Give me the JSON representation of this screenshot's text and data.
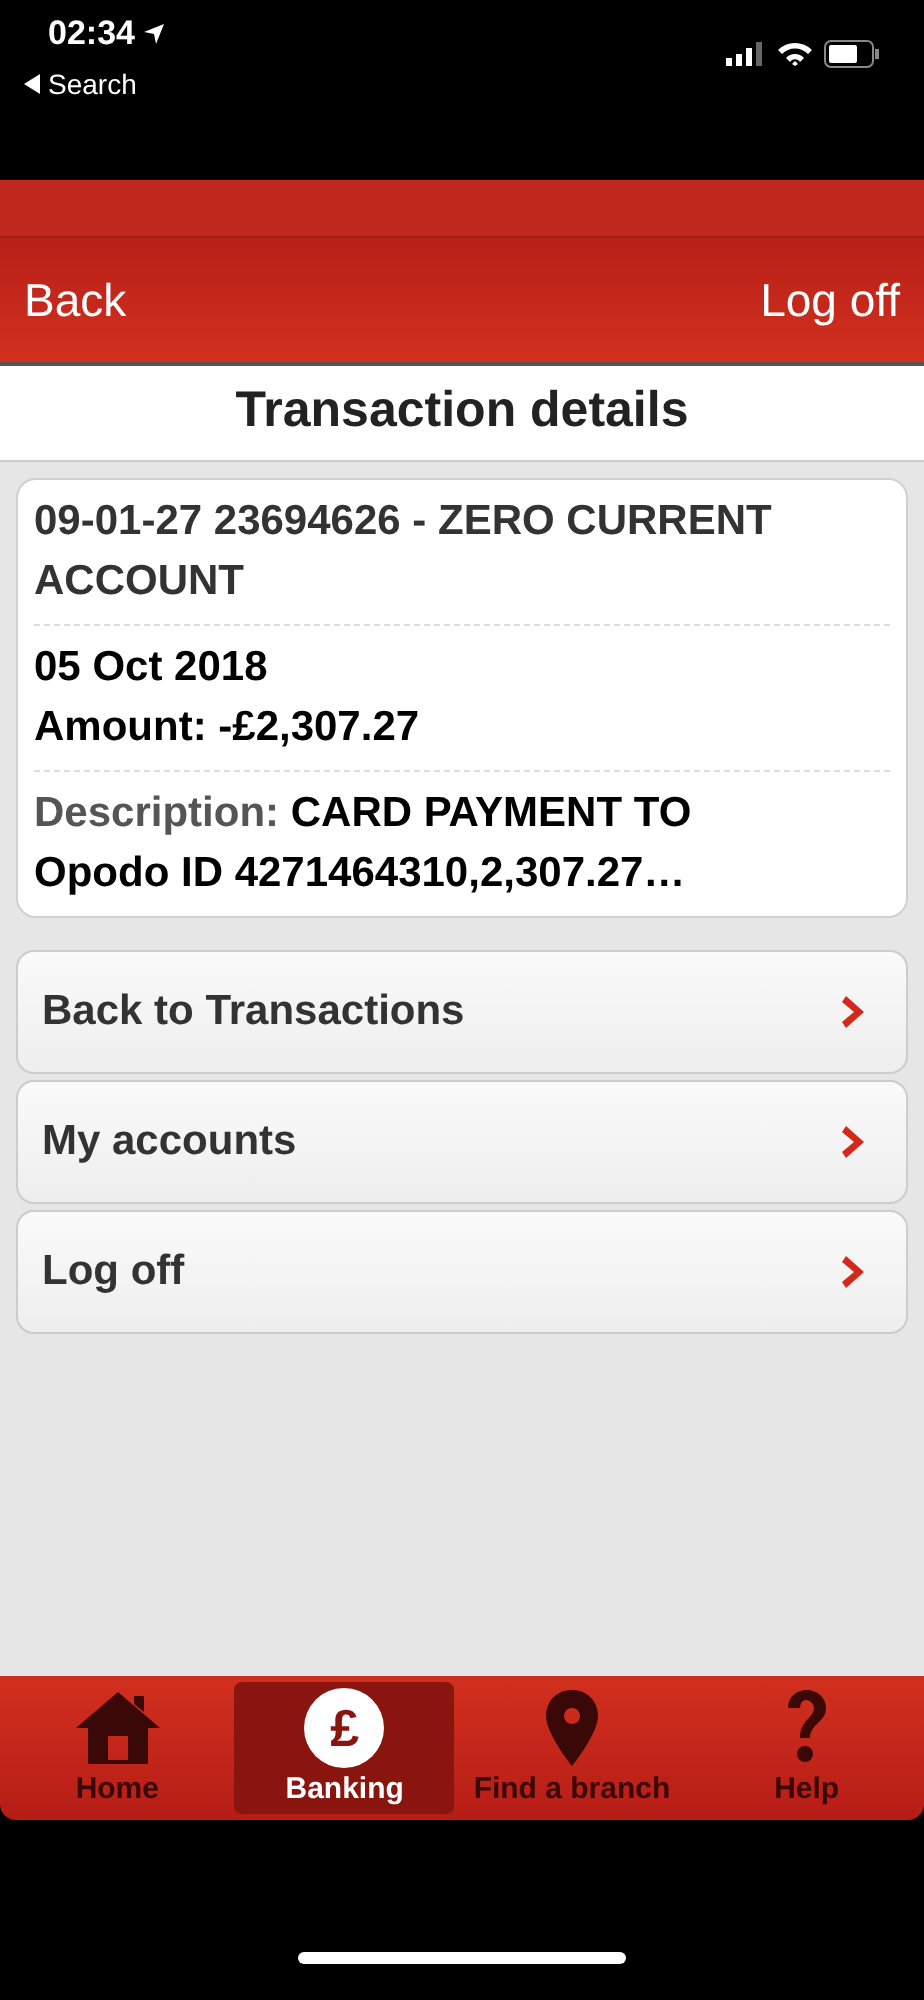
{
  "status_bar": {
    "time": "02:34",
    "back_label": "Search"
  },
  "header": {
    "back": "Back",
    "logoff": "Log off"
  },
  "title": "Transaction details",
  "details": {
    "account": "09-01-27 23694626 - ZERO CURRENT ACCOUNT",
    "date": "05 Oct 2018",
    "amount": "Amount: -£2,307.27",
    "description_label": "Description:",
    "description": "CARD PAYMENT TO Opodo ID 4271464310,2,307.27…"
  },
  "links": [
    {
      "label": "Back to Transactions"
    },
    {
      "label": "My accounts"
    },
    {
      "label": "Log off"
    }
  ],
  "tabs": [
    {
      "label": "Home",
      "kind": "home",
      "selected": false
    },
    {
      "label": "Banking",
      "kind": "banking",
      "icon_text": "£",
      "selected": true
    },
    {
      "label": "Find a branch",
      "kind": "pin",
      "selected": false
    },
    {
      "label": "Help",
      "kind": "help",
      "selected": false
    }
  ]
}
